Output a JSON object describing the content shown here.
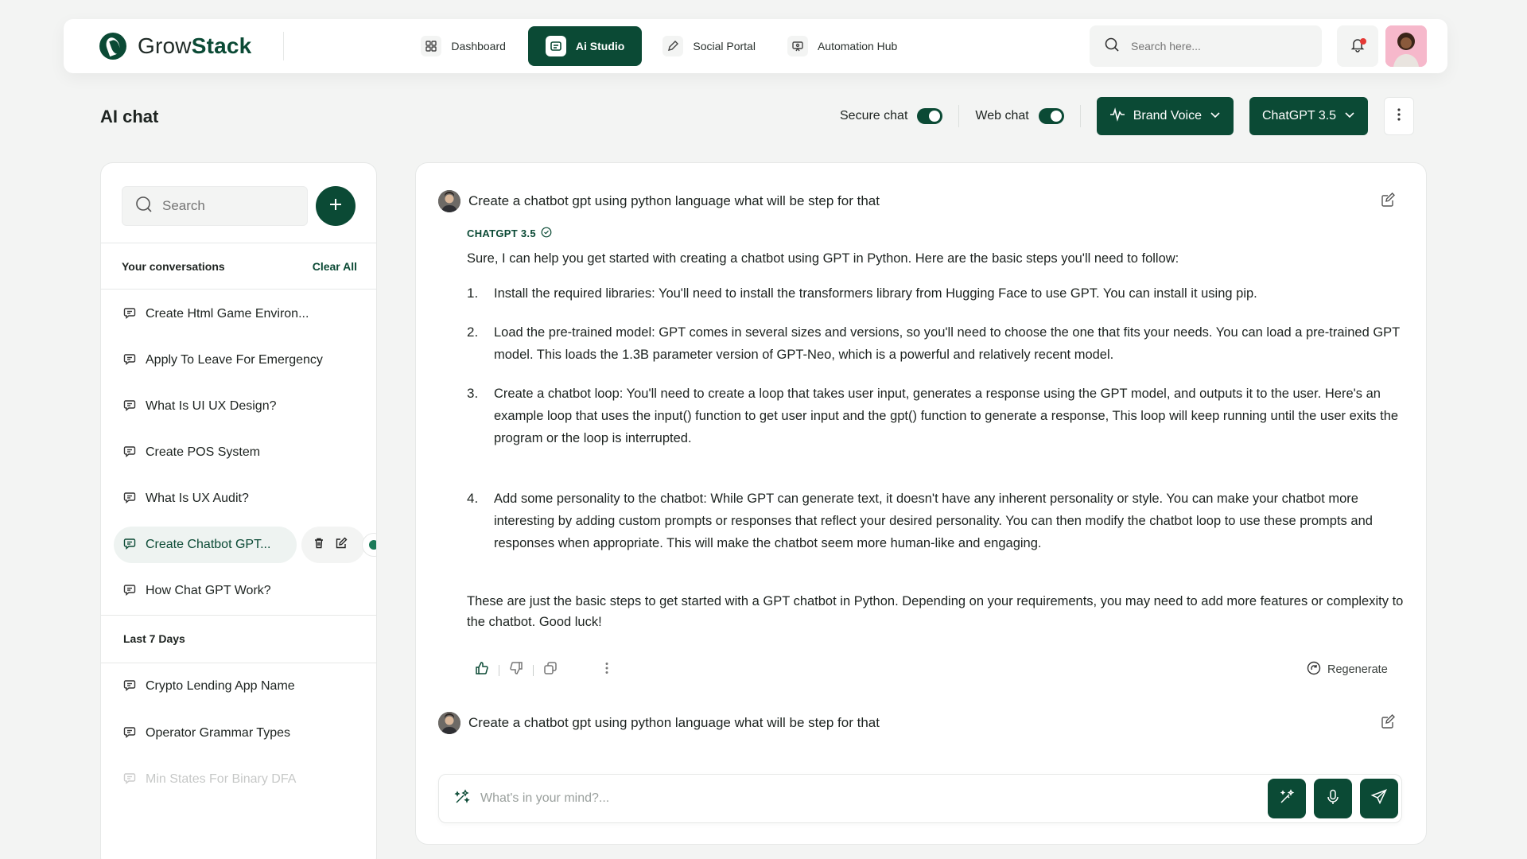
{
  "brand": {
    "name_part1": "Grow",
    "name_part2": "Stack"
  },
  "nav": [
    {
      "label": "Dashboard",
      "icon": "dashboard-icon",
      "active": false
    },
    {
      "label": "Ai Studio",
      "icon": "ai-studio-icon",
      "active": true
    },
    {
      "label": "Social Portal",
      "icon": "pen-icon",
      "active": false
    },
    {
      "label": "Automation Hub",
      "icon": "automation-icon",
      "active": false
    }
  ],
  "top_search": {
    "placeholder": "Search here..."
  },
  "page": {
    "title": "AI chat"
  },
  "controls": {
    "secure_chat_label": "Secure chat",
    "secure_chat_on": true,
    "web_chat_label": "Web chat",
    "web_chat_on": true,
    "brand_voice_label": "Brand Voice",
    "model_label": "ChatGPT 3.5"
  },
  "sidebar": {
    "search_placeholder": "Search",
    "conversations_heading": "Your conversations",
    "clear_all_label": "Clear All",
    "conversations": [
      {
        "label": "Create Html Game Environ..."
      },
      {
        "label": "Apply To Leave For Emergency"
      },
      {
        "label": "What Is UI UX Design?"
      },
      {
        "label": "Create POS System"
      },
      {
        "label": "What Is UX Audit?"
      },
      {
        "label": "Create Chatbot GPT..."
      },
      {
        "label": "How Chat GPT Work?"
      }
    ],
    "active_index": 5,
    "last7_heading": "Last 7 Days",
    "last7": [
      {
        "label": "Crypto Lending App Name"
      },
      {
        "label": "Operator Grammar Types"
      },
      {
        "label": "Min States For Binary DFA"
      }
    ]
  },
  "chat": {
    "user_message_1": "Create a chatbot gpt using python language what will be step for that",
    "model_name": "CHATGPT 3.5",
    "answer_intro": "Sure, I can help you get started with creating a chatbot using GPT in Python. Here are the basic steps you'll need to follow:",
    "steps": [
      {
        "num": "1.",
        "text": "Install the required libraries: You'll need to install the transformers library from Hugging Face to use GPT. You can install it using pip."
      },
      {
        "num": "2.",
        "text": "Load the pre-trained model: GPT comes in several sizes and versions, so you'll need to choose the one that fits your needs. You can load a pre-trained GPT model. This loads the 1.3B parameter version of GPT-Neo, which is a powerful and relatively recent model."
      },
      {
        "num": "3.",
        "text": "Create a chatbot loop: You'll need to create a loop that takes user input, generates a response using the GPT model, and outputs it to the user. Here's an example loop that uses the input() function to get user input and the gpt() function to generate a response, This loop will keep running until the user exits the program or the loop is interrupted."
      },
      {
        "num": "4.",
        "text": "Add some personality to the chatbot: While GPT can generate text, it doesn't have any inherent personality or style. You can make your chatbot more interesting by adding custom prompts or responses that reflect your desired personality. You can then modify the chatbot loop to use these prompts and responses when appropriate. This will make the chatbot seem more human-like and engaging."
      }
    ],
    "closing": "These are just the basic steps to get started with a GPT chatbot in Python. Depending on your requirements, you may need to add more features or complexity to the chatbot. Good luck!",
    "regenerate_label": "Regenerate",
    "user_message_2": "Create a chatbot gpt using python language what will be step for that",
    "composer_placeholder": "What's in your mind?..."
  },
  "colors": {
    "primary": "#0b4a35",
    "background": "#f3f4f3",
    "notification_dot": "#e53935"
  }
}
